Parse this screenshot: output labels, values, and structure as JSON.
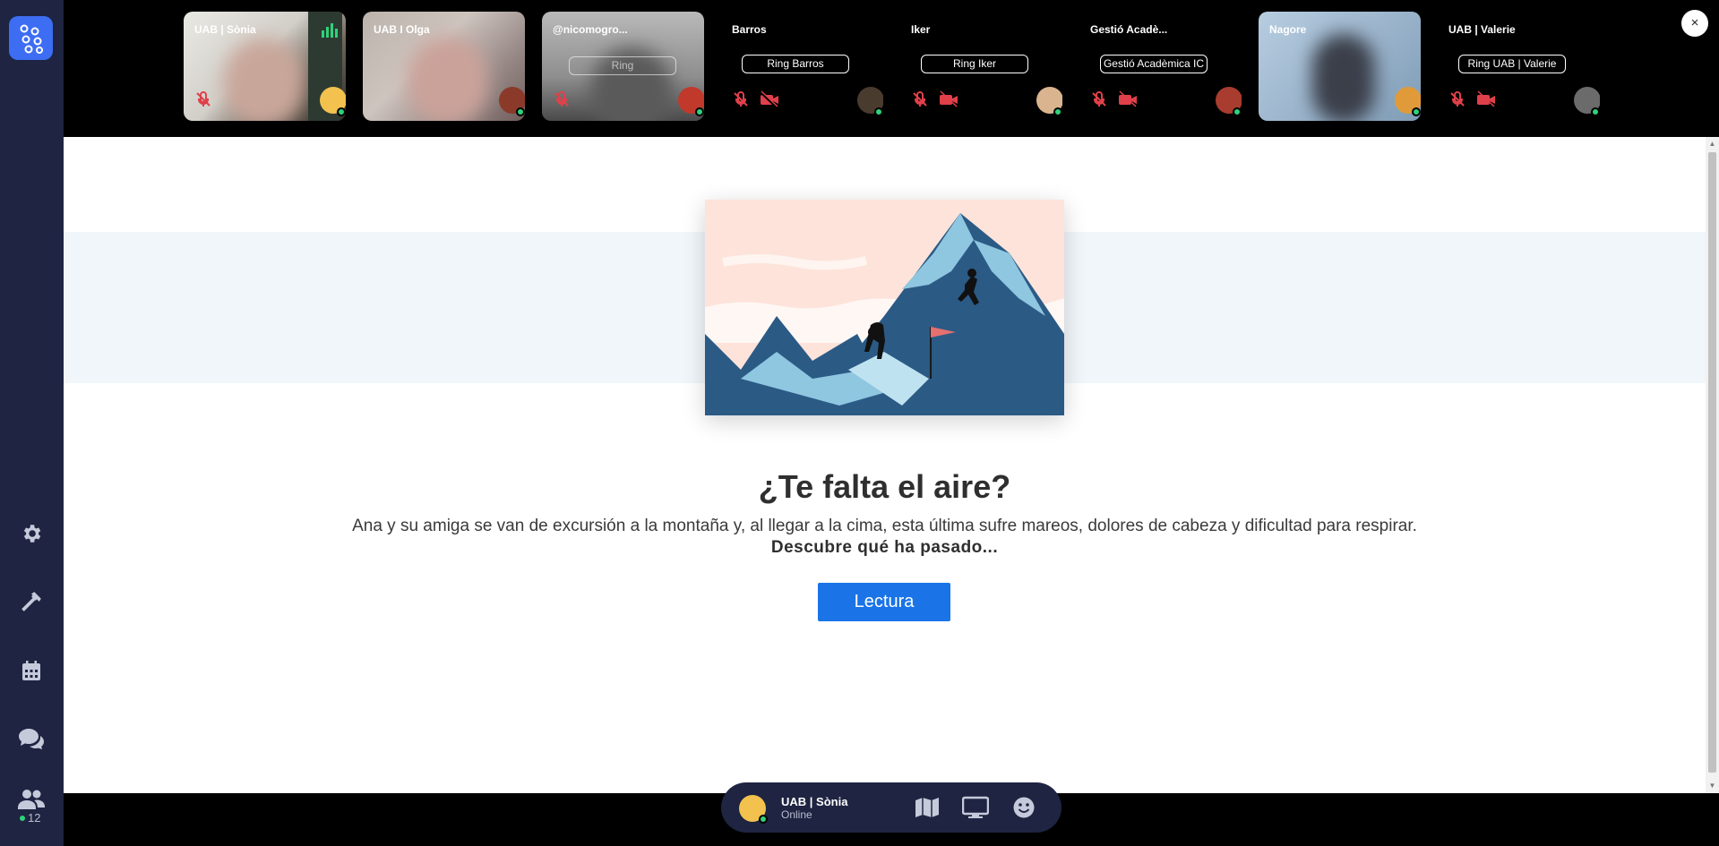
{
  "sidebar": {
    "online_count": "12",
    "items": [
      {
        "name": "settings"
      },
      {
        "name": "build"
      },
      {
        "name": "calendar"
      },
      {
        "name": "chat"
      },
      {
        "name": "participants"
      }
    ]
  },
  "participants": [
    {
      "name": "UAB | Sònia",
      "video": true,
      "muted": true
    },
    {
      "name": "UAB I Olga",
      "video": true,
      "muted": false
    },
    {
      "name": "@nicomogro...",
      "video": true,
      "muted": true,
      "ring_label": "Ring"
    },
    {
      "name": "Barros",
      "video": false,
      "ring_label": "Ring Barros"
    },
    {
      "name": "Iker",
      "video": false,
      "ring_label": "Ring Iker"
    },
    {
      "name": "Gestió Acadè...",
      "video": false,
      "ring_label": "Gestió Acadèmica IC"
    },
    {
      "name": "Nagore",
      "video": true,
      "muted": false
    },
    {
      "name": "UAB | Valerie",
      "video": false,
      "ring_label": "Ring UAB | Valerie"
    }
  ],
  "close_label": "×",
  "content": {
    "title": "¿Te falta el aire?",
    "description": "Ana y su amiga se van de excursión a la montaña y, al llegar a la cima, esta última sufre mareos, dolores de cabeza y dificultad para respirar.",
    "call_to_action": "Descubre qué ha pasado...",
    "button_label": "Lectura"
  },
  "current_user": {
    "name": "UAB | Sònia",
    "status": "Online"
  },
  "colors": {
    "sidebar": "#1e2441",
    "accent": "#3d6df2",
    "button": "#1a74e8",
    "online": "#2ed37a",
    "muted": "#e0404a"
  }
}
